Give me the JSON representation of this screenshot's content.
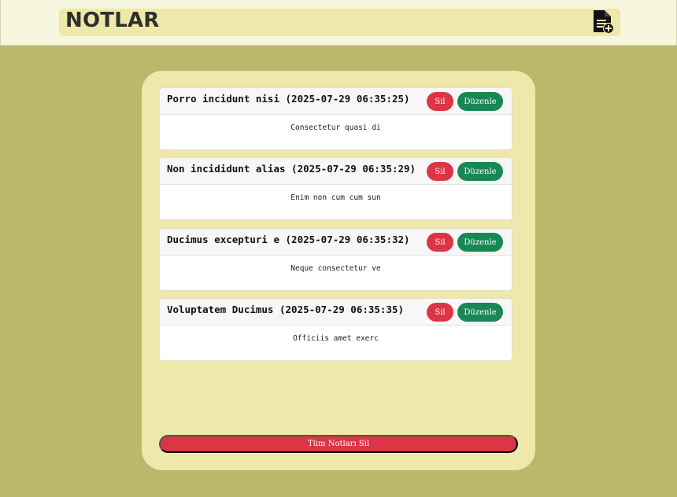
{
  "header": {
    "title": "NOTLAR",
    "add_icon": "add-note-icon"
  },
  "notes": [
    {
      "title": "Porro incidunt nisi (2025-07-29 06:35:25)",
      "body": "Consectetur quasi di",
      "delete_label": "Sil",
      "edit_label": "Düzenle"
    },
    {
      "title": "Non incididunt alias (2025-07-29 06:35:29)",
      "body": "Enim non cum cum sun",
      "delete_label": "Sil",
      "edit_label": "Düzenle"
    },
    {
      "title": "Ducimus excepturi e (2025-07-29 06:35:32)",
      "body": "Neque consectetur ve",
      "delete_label": "Sil",
      "edit_label": "Düzenle"
    },
    {
      "title": "Voluptatem Ducimus (2025-07-29 06:35:35)",
      "body": "Officiis amet exerc",
      "delete_label": "Sil",
      "edit_label": "Düzenle"
    }
  ],
  "delete_all_label": "Tüm Notları Sil",
  "colors": {
    "background": "#bdb76b",
    "panel": "#eee8aa",
    "danger": "#dc3545",
    "success": "#198754"
  }
}
